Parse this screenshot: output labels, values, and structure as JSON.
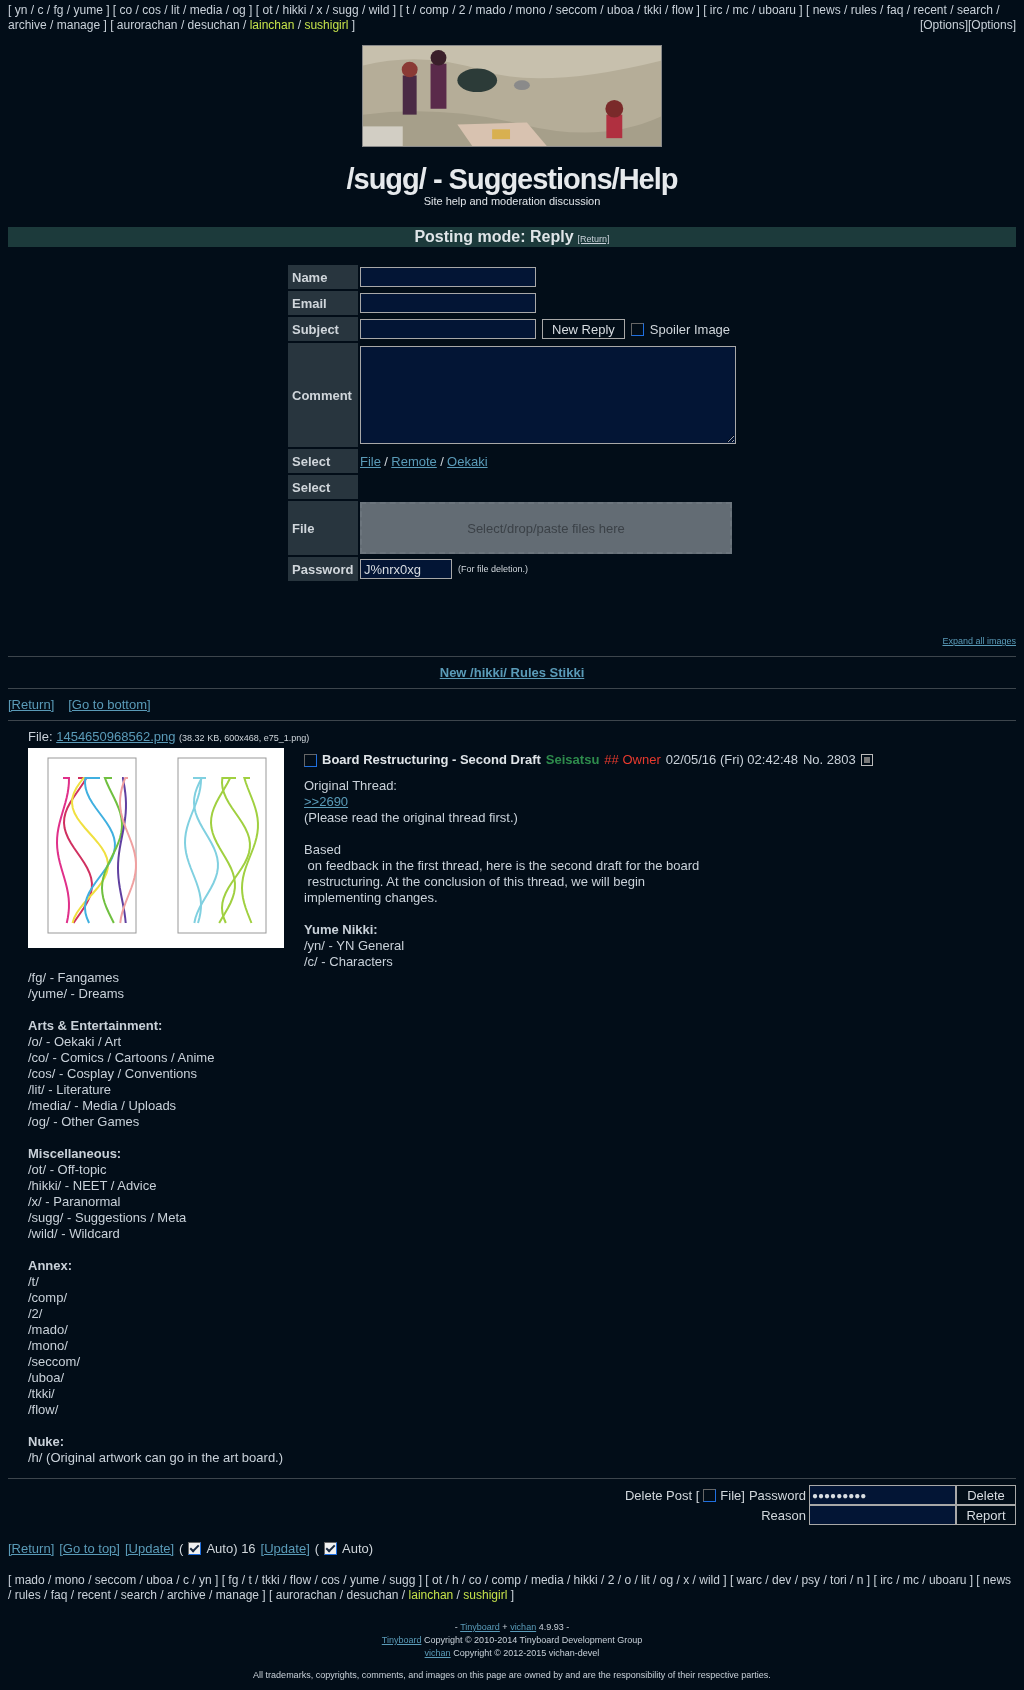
{
  "nav": {
    "open": "[",
    "close": "]",
    "sep": "/",
    "groups": [
      {
        "links": [
          "yn",
          "c",
          "fg",
          "yume"
        ]
      },
      {
        "links": [
          "co",
          "cos",
          "lit",
          "media",
          "og"
        ]
      },
      {
        "links": [
          "ot",
          "hikki",
          "x",
          "sugg",
          "wild"
        ]
      },
      {
        "links": [
          "t",
          "comp",
          "2",
          "mado",
          "mono",
          "seccom",
          "uboa",
          "tkki",
          "flow"
        ]
      },
      {
        "links": [
          "irc",
          "mc",
          "uboaru"
        ]
      },
      {
        "links": [
          "news",
          "rules",
          "faq",
          "recent",
          "search",
          "archive",
          "manage"
        ]
      },
      {
        "links": [
          "aurorachan",
          "desuchan"
        ],
        "featured": [
          "lainchan",
          "sushigirl"
        ]
      }
    ]
  },
  "options": "[Options][Options]",
  "board": {
    "title": "/sugg/ - Suggestions/Help",
    "subtitle": "Site help and moderation discussion"
  },
  "posting_mode": {
    "text": "Posting mode: Reply",
    "link": "[Return]"
  },
  "form": {
    "rows": [
      {
        "kind": "input",
        "label": "Name"
      },
      {
        "kind": "input",
        "label": "Email"
      },
      {
        "kind": "subject",
        "label": "Subject",
        "button": "New Reply",
        "spoiler": {
          "label": "Spoiler Image",
          "checked": false
        }
      },
      {
        "kind": "textarea",
        "label": "Comment"
      },
      {
        "kind": "links",
        "label": "Select",
        "links": [
          "File",
          "Remote",
          "Oekaki"
        ],
        "sep": "/"
      },
      {
        "kind": "empty",
        "label": "Select"
      },
      {
        "kind": "dropzone",
        "label": "File",
        "text": "Select/drop/paste files here"
      },
      {
        "kind": "password",
        "label": "Password",
        "value": "J%nrx0xg",
        "note": "(For file deletion.)"
      }
    ]
  },
  "expand": "Expand all images",
  "stikki": "New /hikki/ Rules Stikki",
  "thread_nav": [
    "[Return]",
    "[Go to bottom]"
  ],
  "post": {
    "file_label": "File:",
    "file_name": "1454650968562.png",
    "file_info": "(38.32 KB, 600x468, e75_1.png)",
    "checked": false,
    "subject": "Board Restructuring - Second Draft",
    "name": "Seisatsu",
    "capcode": "## Owner",
    "date": "02/05/16 (Fri) 02:42:48",
    "number": "No. 2803",
    "body": [
      {
        "kind": "text",
        "text": "Original Thread:"
      },
      {
        "kind": "link",
        "text": ">>2690"
      },
      {
        "kind": "text",
        "text": "(Please read the original thread first.)"
      },
      {
        "kind": "blank"
      },
      {
        "kind": "text",
        "text": "Based"
      },
      {
        "kind": "text",
        "text": " on feedback in the first thread, here is the second draft for the board"
      },
      {
        "kind": "text",
        "text": " restructuring. At the conclusion of this thread, we will begin"
      },
      {
        "kind": "text",
        "text": "implementing changes."
      },
      {
        "kind": "blank"
      },
      {
        "kind": "heading",
        "text": "Yume Nikki:"
      },
      {
        "kind": "text",
        "text": "/yn/ - YN General"
      },
      {
        "kind": "text",
        "text": "/c/ - Characters"
      },
      {
        "kind": "text",
        "text": "/fg/ - Fangames"
      },
      {
        "kind": "text",
        "text": "/yume/ - Dreams"
      },
      {
        "kind": "blank"
      },
      {
        "kind": "heading",
        "text": "Arts & Entertainment:"
      },
      {
        "kind": "text",
        "text": "/o/ - Oekaki / Art"
      },
      {
        "kind": "text",
        "text": "/co/ - Comics / Cartoons / Anime"
      },
      {
        "kind": "text",
        "text": "/cos/ - Cosplay / Conventions"
      },
      {
        "kind": "text",
        "text": "/lit/ - Literature"
      },
      {
        "kind": "text",
        "text": "/media/ - Media / Uploads"
      },
      {
        "kind": "text",
        "text": "/og/ - Other Games"
      },
      {
        "kind": "blank"
      },
      {
        "kind": "heading",
        "text": "Miscellaneous:"
      },
      {
        "kind": "text",
        "text": "/ot/ - Off-topic"
      },
      {
        "kind": "text",
        "text": "/hikki/ - NEET / Advice"
      },
      {
        "kind": "text",
        "text": "/x/ - Paranormal"
      },
      {
        "kind": "text",
        "text": "/sugg/ - Suggestions / Meta"
      },
      {
        "kind": "text",
        "text": "/wild/ - Wildcard"
      },
      {
        "kind": "blank"
      },
      {
        "kind": "heading",
        "text": "Annex:"
      },
      {
        "kind": "text",
        "text": "/t/"
      },
      {
        "kind": "text",
        "text": "/comp/"
      },
      {
        "kind": "text",
        "text": "/2/"
      },
      {
        "kind": "text",
        "text": "/mado/"
      },
      {
        "kind": "text",
        "text": "/mono/"
      },
      {
        "kind": "text",
        "text": "/seccom/"
      },
      {
        "kind": "text",
        "text": "/uboa/"
      },
      {
        "kind": "text",
        "text": "/tkki/"
      },
      {
        "kind": "text",
        "text": "/flow/"
      },
      {
        "kind": "blank"
      },
      {
        "kind": "heading",
        "text": "Nuke:"
      },
      {
        "kind": "text",
        "text": "/h/ (Original artwork can go in the art board.)"
      }
    ]
  },
  "delete": {
    "label": "Delete Post [",
    "file": {
      "label": "File]",
      "checked": false
    },
    "password_label": "Password",
    "password": "●●●●●●●●●",
    "delete_button": "Delete",
    "reason_label": "Reason",
    "report_button": "Report"
  },
  "bottom_nav": [
    {
      "kind": "link",
      "text": "[Return]"
    },
    {
      "kind": "link",
      "text": "[Go to top]"
    },
    {
      "kind": "link",
      "text": "[Update]"
    },
    {
      "kind": "text",
      "text": "("
    },
    {
      "kind": "checkbox",
      "text": "Auto) 16",
      "checked": true
    },
    {
      "kind": "link",
      "text": "[Update]"
    },
    {
      "kind": "text",
      "text": "("
    },
    {
      "kind": "checkbox",
      "text": "Auto)",
      "checked": true
    }
  ],
  "footer_nav": {
    "open": "[",
    "close": "]",
    "sep": "/",
    "groups": [
      {
        "links": [
          "mado",
          "mono",
          "seccom",
          "uboa",
          "c",
          "yn"
        ]
      },
      {
        "links": [
          "fg",
          "t",
          "tkki",
          "flow",
          "cos",
          "yume",
          "sugg"
        ]
      },
      {
        "links": [
          "ot",
          "h",
          "co",
          "comp",
          "media",
          "hikki",
          "2",
          "o",
          "lit",
          "og",
          "x",
          "wild"
        ]
      },
      {
        "links": [
          "warc",
          "dev",
          "psy",
          "tori",
          "n"
        ]
      },
      {
        "links": [
          "irc",
          "mc",
          "uboaru"
        ]
      },
      {
        "links": [
          "news",
          "rules",
          "faq",
          "recent",
          "search",
          "archive",
          "manage"
        ]
      },
      {
        "links": [
          "aurorachan",
          "desuchan"
        ],
        "featured": [
          "lainchan",
          "sushigirl"
        ]
      }
    ]
  },
  "footer": [
    [
      {
        "kind": "text",
        "text": "-"
      },
      {
        "kind": "link",
        "text": "Tinyboard"
      },
      {
        "kind": "text",
        "text": "+"
      },
      {
        "kind": "link",
        "text": "vichan"
      },
      {
        "kind": "text",
        "text": "4.9.93 -"
      }
    ],
    [
      {
        "kind": "link",
        "text": "Tinyboard"
      },
      {
        "kind": "text",
        "text": "Copyright © 2010-2014 Tinyboard Development Group"
      }
    ],
    [
      {
        "kind": "link",
        "text": "vichan"
      },
      {
        "kind": "text",
        "text": "Copyright © 2012-2015 vichan-devel"
      }
    ]
  ],
  "disclaimer": "All trademarks, copyrights, comments, and images on this page are owned by and are the responsibility of their respective parties."
}
